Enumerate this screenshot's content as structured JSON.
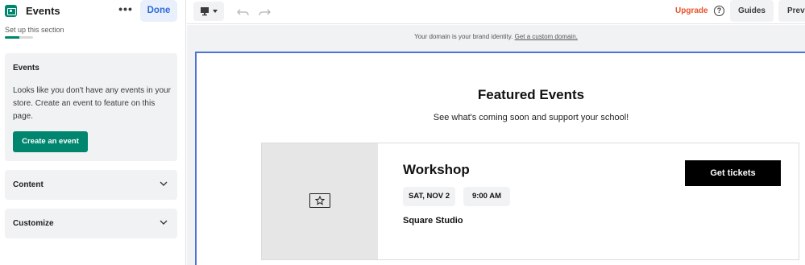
{
  "sidebar": {
    "title": "Events",
    "more_label": "•••",
    "done_label": "Done",
    "setup_text": "Set up this section",
    "setup_progress": 0.5,
    "events_panel": {
      "heading": "Events",
      "body": "Looks like you don't have any events in your store. Create an event to feature on this page.",
      "button_label": "Create an event"
    },
    "content_label": "Content",
    "customize_label": "Customize"
  },
  "toolbar": {
    "upgrade_label": "Upgrade",
    "help_label": "?",
    "guides_label": "Guides",
    "preview_label": "Preview"
  },
  "canvas": {
    "domain_text": "Your domain is your brand identity.",
    "domain_link": "Get a custom domain."
  },
  "section": {
    "title": "Featured Events",
    "subtitle": "See what's coming soon and support your school!",
    "event": {
      "name": "Workshop",
      "date": "SAT, NOV 2",
      "time": "9:00 AM",
      "location": "Square Studio",
      "button_label": "Get tickets"
    }
  },
  "colors": {
    "accent_green": "#00856f",
    "upgrade_orange": "#e8512a",
    "done_blue": "#2b6bd6",
    "frame_blue": "#4a73d4"
  },
  "icons": {
    "app": "ticket-icon",
    "device": "desktop-icon",
    "undo": "undo-icon",
    "redo": "redo-icon",
    "help": "help-icon",
    "chevron": "chevron-down-icon",
    "image_placeholder": "star-frame-icon"
  }
}
